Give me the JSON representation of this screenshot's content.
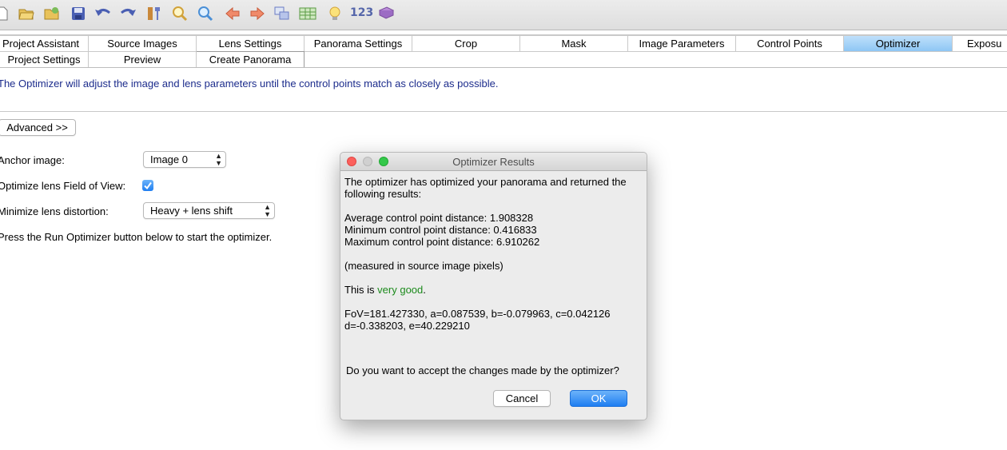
{
  "toolbar": {
    "icons": [
      "new-file-icon",
      "open-folder-icon",
      "open-recent-icon",
      "save-icon",
      "undo-icon",
      "redo-icon",
      "tools-icon",
      "zoom-in-icon",
      "zoom-out-icon",
      "arrow-left-icon",
      "arrow-right-icon",
      "windows-icon",
      "table-icon",
      "lightbulb-icon",
      "number-icon",
      "book-icon"
    ],
    "number_label": "123"
  },
  "tabs_row1": [
    "Project Assistant",
    "Source Images",
    "Lens Settings",
    "Panorama Settings",
    "Crop",
    "Mask",
    "Image Parameters",
    "Control Points",
    "Optimizer",
    "Exposu"
  ],
  "tabs_row2": [
    "Project Settings",
    "Preview",
    "Create Panorama"
  ],
  "active_tab": "Optimizer",
  "description": "The Optimizer will adjust the image and lens parameters until the control points match as closely as possible.",
  "advanced_button": "Advanced >>",
  "form": {
    "anchor_label": "Anchor image:",
    "anchor_value": "Image 0",
    "fov_label": "Optimize lens Field of View:",
    "fov_checked": true,
    "distortion_label": "Minimize lens distortion:",
    "distortion_value": "Heavy + lens shift",
    "hint": "Press the Run Optimizer button below to start the optimizer."
  },
  "dialog": {
    "title": "Optimizer Results",
    "intro_line1": "The optimizer has optimized your panorama and returned the",
    "intro_line2": "following results:",
    "avg": "Average control point distance: 1.908328",
    "min": "Minimum control point distance: 0.416833",
    "max": "Maximum control point distance: 6.910262",
    "measured": "(measured in source image pixels)",
    "quality_prefix": "This is ",
    "quality_value": "very good",
    "quality_suffix": ".",
    "params_line1": "FoV=181.427330, a=0.087539, b=-0.079963, c=0.042126",
    "params_line2": "d=-0.338203, e=40.229210",
    "question": "Do you want to accept the changes made by the optimizer?",
    "cancel": "Cancel",
    "ok": "OK"
  },
  "colors": {
    "accent": "#1e7ef0",
    "description_text": "#1c2c8c",
    "good": "#1b8a1b",
    "tab_active": "#a6d3f8"
  }
}
